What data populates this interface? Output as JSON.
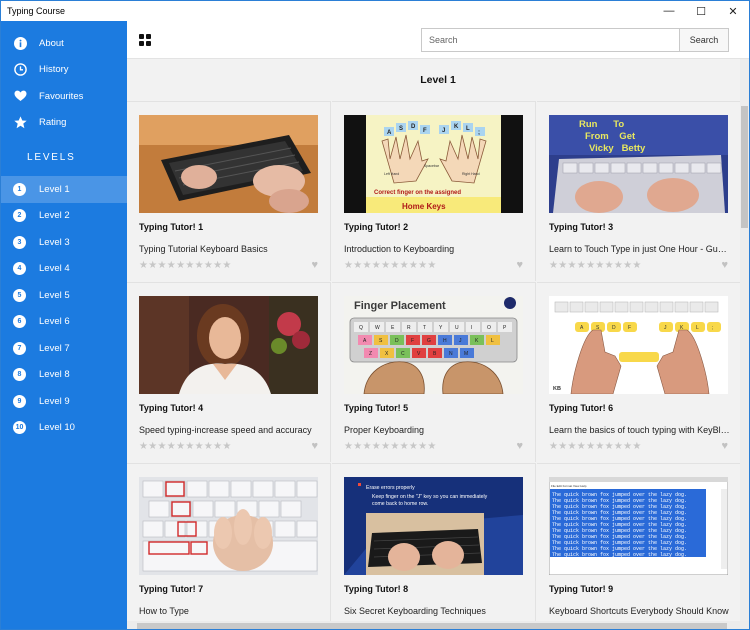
{
  "window": {
    "title": "Typing Course",
    "minimize": "—",
    "maximize": "☐",
    "close": "✕"
  },
  "sidebar": {
    "nav": [
      {
        "label": "About",
        "icon": "info-icon"
      },
      {
        "label": "History",
        "icon": "clock-icon"
      },
      {
        "label": "Favourites",
        "icon": "heart-icon"
      },
      {
        "label": "Rating",
        "icon": "star-icon"
      }
    ],
    "levels_heading": "LEVELS",
    "levels": [
      {
        "num": "1",
        "label": "Level 1"
      },
      {
        "num": "2",
        "label": "Level 2"
      },
      {
        "num": "3",
        "label": "Level 3"
      },
      {
        "num": "4",
        "label": "Level 4"
      },
      {
        "num": "5",
        "label": "Level 5"
      },
      {
        "num": "6",
        "label": "Level 6"
      },
      {
        "num": "7",
        "label": "Level 7"
      },
      {
        "num": "8",
        "label": "Level 8"
      },
      {
        "num": "9",
        "label": "Level 9"
      },
      {
        "num": "10",
        "label": "Level 10"
      }
    ],
    "active_level": 0
  },
  "search": {
    "placeholder": "Search",
    "button": "Search"
  },
  "content": {
    "heading": "Level 1",
    "videos": [
      {
        "title": "Typing Tutor! 1",
        "desc": "Typing Tutorial Keyboard Basics"
      },
      {
        "title": "Typing Tutor! 2",
        "desc": "Introduction to Keyboarding"
      },
      {
        "title": "Typing Tutor! 3",
        "desc": "Learn to Touch Type in just One Hour - Guaranteed"
      },
      {
        "title": "Typing Tutor! 4",
        "desc": "Speed typing-increase speed and accuracy"
      },
      {
        "title": "Typing Tutor! 5",
        "desc": "Proper Keyboarding"
      },
      {
        "title": "Typing Tutor! 6",
        "desc": "Learn the basics of touch typing with KeyBlaze"
      },
      {
        "title": "Typing Tutor! 7",
        "desc": "How to Type"
      },
      {
        "title": "Typing Tutor! 8",
        "desc": "Six Secret Keyboarding Techniques"
      },
      {
        "title": "Typing Tutor! 9",
        "desc": "Keyboard Shortcuts Everybody Should Know"
      }
    ]
  },
  "thumbs": {
    "t2_title": "Correct finger on the assigned",
    "t2_sub": "Home Keys",
    "t2_left": "Left Hand",
    "t2_right": "Right Hand",
    "t2_space": "Spacebar",
    "t2_keys": [
      "A",
      "S",
      "D",
      "F",
      "J",
      "K",
      "L",
      ";"
    ],
    "t3_l1": "Run      To",
    "t3_l2": "From    Get",
    "t3_l3": "Vicky   Betty",
    "t5_title": "Finger Placement",
    "t5_keys": [
      "Q",
      "W",
      "E",
      "R",
      "T",
      "Y",
      "U",
      "I",
      "O",
      "P",
      "A",
      "S",
      "D",
      "F",
      "G",
      "H",
      "J",
      "K",
      "L",
      "Z",
      "X",
      "C",
      "V",
      "B",
      "N",
      "M"
    ],
    "t6_keys": [
      "A",
      "S",
      "D",
      "F",
      "J",
      "K",
      "L",
      ";"
    ],
    "t6_logo": "KB",
    "t8_l1": "Erase errors properly",
    "t8_l2": "Keep finger on the \"J\" key so you can immediately",
    "t8_l3": "come back to home row.",
    "t9_menu": "File  Edit  Format  View  Help",
    "t9_line": "The quick brown fox jumped over the lazy dog."
  },
  "colors": {
    "sidebar": "#1c7be0",
    "sidebar_active": "#4a95e6",
    "main_bg": "#f2f2f2"
  }
}
